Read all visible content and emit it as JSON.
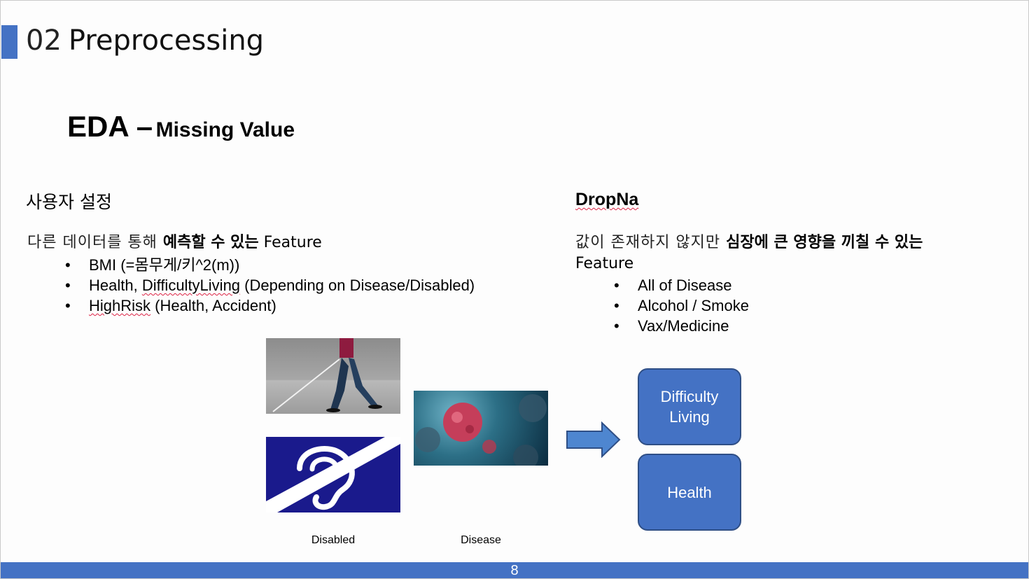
{
  "title": {
    "number": "02",
    "text": "Preprocessing"
  },
  "subtitle": {
    "main": "EDA –",
    "sub": "Missing Value"
  },
  "left_section": {
    "heading": "사용자 설정",
    "intro_light": "다른 데이터를 통해 ",
    "intro_bold": "예측할 수 있는",
    "intro_end": " Feature",
    "bullets": [
      {
        "pre": "BMI (=몸무게/키^2(m))",
        "flag": "",
        "post": ""
      },
      {
        "pre": "Health, ",
        "flag": "DifficultyLiving",
        "post": " (Depending on Disease/Disabled)"
      },
      {
        "pre": "",
        "flag": "HighRisk",
        "post": " (Health, Accident)"
      }
    ]
  },
  "right_section": {
    "heading": "DropNa",
    "intro_light": "값이 존재하지 않지만 ",
    "intro_bold": "심장에 큰 영향을 끼칠 수 있는",
    "intro_end": "Feature",
    "bullets": [
      "All of Disease",
      "Alcohol / Smoke",
      "Vax/Medicine"
    ]
  },
  "captions": {
    "disabled": "Disabled",
    "disease": "Disease"
  },
  "boxes": [
    "Difficulty Living",
    "Health"
  ],
  "page_number": "8",
  "colors": {
    "accent": "#4472c4",
    "box_border": "#2f4f86",
    "ear_bg": "#1a1a8c"
  },
  "icons": [
    "walking-person-image",
    "hearing-impaired-icon",
    "virus-image",
    "right-arrow-icon"
  ]
}
